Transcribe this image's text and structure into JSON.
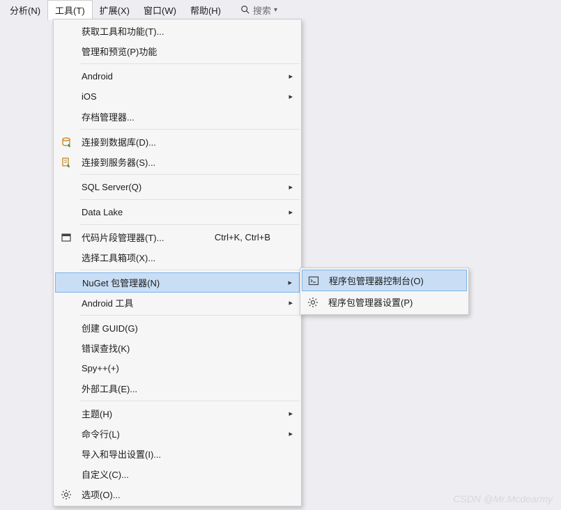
{
  "menubar": {
    "items": [
      {
        "label": "分析(N)"
      },
      {
        "label": "工具(T)"
      },
      {
        "label": "扩展(X)"
      },
      {
        "label": "窗口(W)"
      },
      {
        "label": "帮助(H)"
      }
    ],
    "search": {
      "label": "搜索"
    }
  },
  "menu": {
    "items": [
      {
        "label": "获取工具和功能(T)..."
      },
      {
        "label": "管理和预览(P)功能"
      },
      {
        "label": "Android",
        "submenu": true
      },
      {
        "label": "iOS",
        "submenu": true
      },
      {
        "label": "存档管理器..."
      },
      {
        "label": "连接到数据库(D)...",
        "icon": "database"
      },
      {
        "label": "连接到服务器(S)...",
        "icon": "server"
      },
      {
        "label": "SQL Server(Q)",
        "submenu": true
      },
      {
        "label": "Data Lake",
        "submenu": true
      },
      {
        "label": "代码片段管理器(T)...",
        "icon": "snippet",
        "shortcut": "Ctrl+K, Ctrl+B"
      },
      {
        "label": "选择工具箱项(X)..."
      },
      {
        "label": "NuGet 包管理器(N)",
        "submenu": true,
        "highlighted": true
      },
      {
        "label": "Android 工具",
        "submenu": true
      },
      {
        "label": "创建 GUID(G)"
      },
      {
        "label": "错误查找(K)"
      },
      {
        "label": "Spy++(+)"
      },
      {
        "label": "外部工具(E)..."
      },
      {
        "label": "主题(H)",
        "submenu": true
      },
      {
        "label": "命令行(L)",
        "submenu": true
      },
      {
        "label": "导入和导出设置(I)..."
      },
      {
        "label": "自定义(C)..."
      },
      {
        "label": "选项(O)...",
        "icon": "gear"
      }
    ]
  },
  "submenu": {
    "items": [
      {
        "label": "程序包管理器控制台(O)",
        "icon": "console",
        "highlighted": true
      },
      {
        "label": "程序包管理器设置(P)",
        "icon": "gear"
      }
    ]
  },
  "watermark": "CSDN @Mr.Mcdearmy"
}
